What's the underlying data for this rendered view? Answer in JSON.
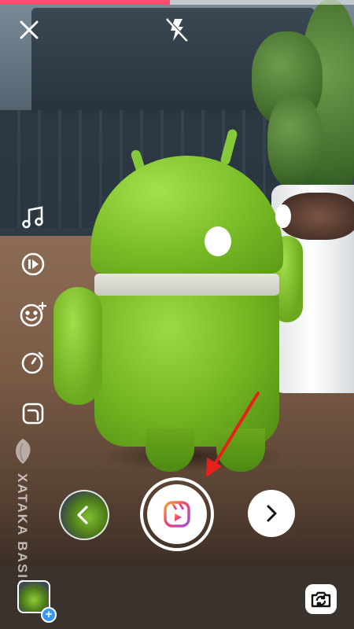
{
  "camera": {
    "close_icon": "close-icon",
    "flash_icon": "flash-off-icon",
    "recording_progress": 0.48
  },
  "tools": [
    {
      "name": "music",
      "icon": "music-note-icon"
    },
    {
      "name": "speed",
      "icon": "speed-icon"
    },
    {
      "name": "effects",
      "icon": "smiley-sparkle-icon"
    },
    {
      "name": "timer",
      "icon": "timer-icon"
    },
    {
      "name": "layout",
      "icon": "layout-icon"
    }
  ],
  "watermark": {
    "text": "XATAKA BASICS"
  },
  "capture": {
    "shutter_icon": "reels-icon",
    "next_icon": "chevron-right-icon",
    "effect_icon": "chevron-left-icon"
  },
  "bottom": {
    "plus_label": "+",
    "flip_icon": "camera-flip-icon"
  },
  "colors": {
    "progress": "#ff4d6d",
    "arrow": "#e8201a",
    "badge": "#3897f0"
  }
}
